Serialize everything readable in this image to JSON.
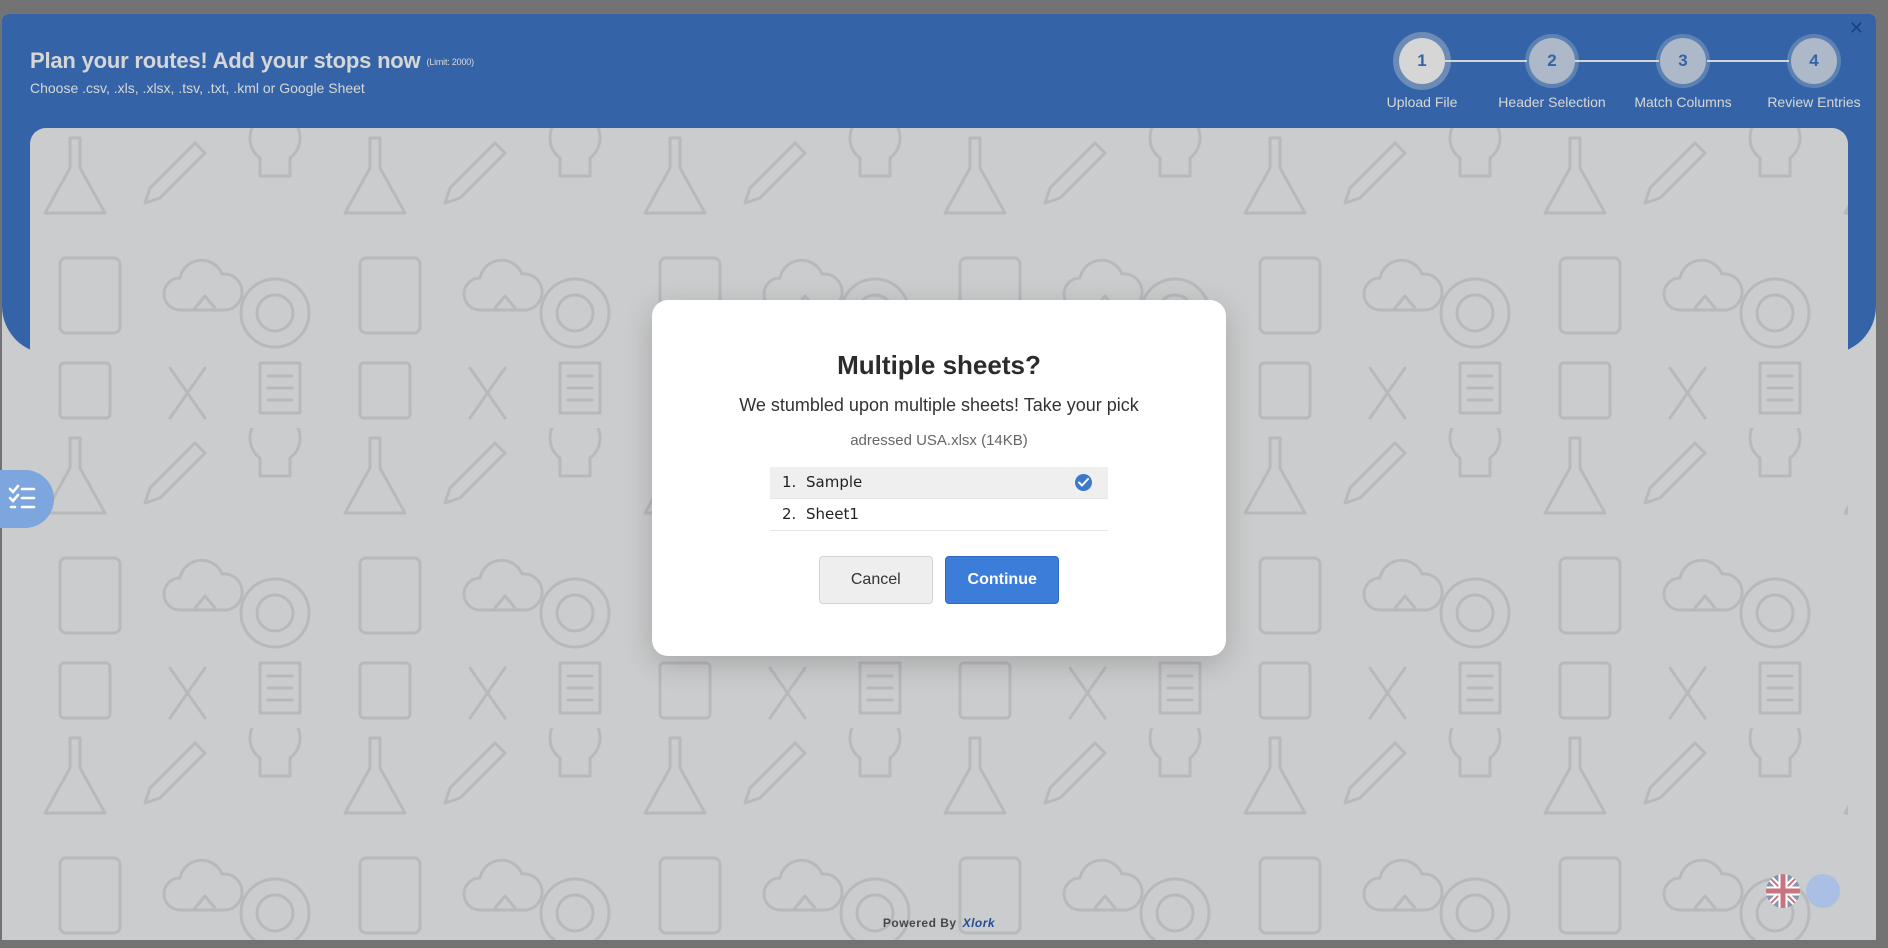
{
  "header": {
    "title": "Plan your routes! Add your stops now",
    "limit": "(Limit: 2000)",
    "subtitle": "Choose .csv, .xls, .xlsx, .tsv, .txt, .kml or Google Sheet",
    "close_icon": "close-icon"
  },
  "steps": [
    {
      "number": "1",
      "label": "Upload File",
      "active": true
    },
    {
      "number": "2",
      "label": "Header Selection",
      "active": false
    },
    {
      "number": "3",
      "label": "Match Columns",
      "active": false
    },
    {
      "number": "4",
      "label": "Review Entries",
      "active": false
    }
  ],
  "footer": {
    "powered_by": "Powered By",
    "brand": "Xlork"
  },
  "modal": {
    "title": "Multiple sheets?",
    "message": "We stumbled upon multiple sheets! Take your pick",
    "file_name": "adressed USA.xlsx (14KB)",
    "sheets": [
      {
        "number": "1.",
        "name": "Sample",
        "selected": true
      },
      {
        "number": "2.",
        "name": "Sheet1",
        "selected": false
      }
    ],
    "cancel_label": "Cancel",
    "continue_label": "Continue"
  },
  "widgets": {
    "side_tab_icon": "checklist-icon",
    "language_icon": "uk-flag-icon",
    "chat_icon": "chat-bubble-icon"
  },
  "colors": {
    "primary": "#3e78c8",
    "button": "#3b7dd8",
    "background": "#f2f3f5"
  }
}
